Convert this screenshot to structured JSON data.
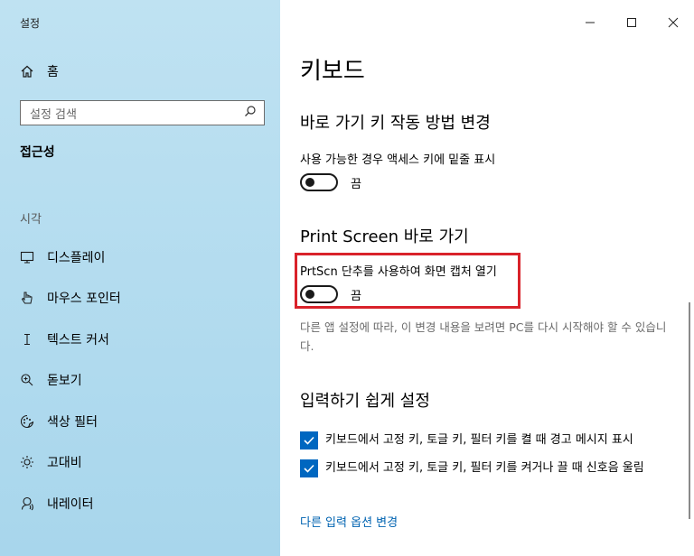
{
  "window": {
    "title": "설정"
  },
  "sidebar": {
    "home_label": "홈",
    "search_placeholder": "설정 검색",
    "current_section": "접근성",
    "group_label": "시각",
    "items": [
      {
        "label": "디스플레이",
        "icon": "monitor-icon"
      },
      {
        "label": "마우스 포인터",
        "icon": "pointer-icon"
      },
      {
        "label": "텍스트 커서",
        "icon": "text-cursor-icon"
      },
      {
        "label": "돋보기",
        "icon": "magnifier-icon"
      },
      {
        "label": "색상 필터",
        "icon": "color-filter-icon"
      },
      {
        "label": "고대비",
        "icon": "brightness-icon"
      },
      {
        "label": "내레이터",
        "icon": "narrator-icon"
      }
    ]
  },
  "main": {
    "title": "키보드",
    "shortcut_section": {
      "heading": "바로 가기 키 작동 방법 변경",
      "option_label": "사용 가능한 경우 액세스 키에 밑줄 표시",
      "toggle_state": "끔"
    },
    "printscreen_section": {
      "heading": "Print Screen 바로 가기",
      "option_label": "PrtScn 단추를 사용하여 화면 캡처 열기",
      "toggle_state": "끔",
      "note": "다른 앱 설정에 따라, 이 변경 내용을 보려면 PC를 다시 시작해야 할 수 있습니다."
    },
    "typing_section": {
      "heading": "입력하기 쉽게 설정",
      "checkbox_1": "키보드에서 고정 키, 토글 키, 필터 키를 켤 때 경고 메시지 표시",
      "checkbox_2": "키보드에서 고정 키, 토글 키, 필터 키를 켜거나 끌 때 신호음 울림",
      "link": "다른 입력 옵션 변경"
    }
  },
  "colors": {
    "accent": "#0067c0",
    "highlight": "#d9222a",
    "link": "#0063b1"
  }
}
